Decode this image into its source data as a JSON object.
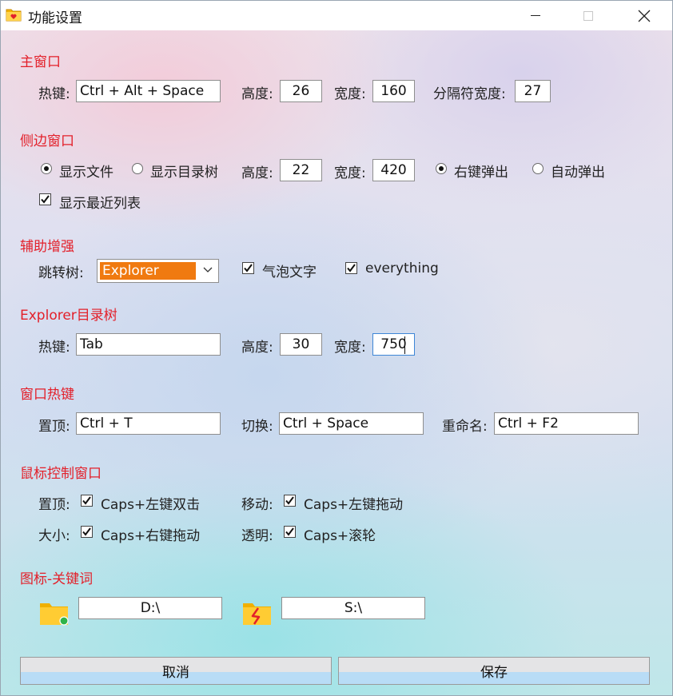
{
  "window": {
    "title": "功能设置"
  },
  "main_window": {
    "title": "主窗口",
    "hotkey_label": "热键:",
    "hotkey_value": "Ctrl + Alt + Space",
    "height_label": "高度:",
    "height_value": "26",
    "width_label": "宽度:",
    "width_value": "160",
    "separator_width_label": "分隔符宽度:",
    "separator_width_value": "27"
  },
  "side_window": {
    "title": "侧边窗口",
    "radio_show_files": "显示文件",
    "radio_show_tree": "显示目录树",
    "show_mode_selected": "显示文件",
    "height_label": "高度:",
    "height_value": "22",
    "width_label": "宽度:",
    "width_value": "420",
    "radio_right_click": "右键弹出",
    "radio_auto_popup": "自动弹出",
    "popup_mode_selected": "右键弹出",
    "show_recent_label": "显示最近列表",
    "show_recent_checked": true
  },
  "assist": {
    "title": "辅助增强",
    "jump_tree_label": "跳转树:",
    "jump_tree_value": "Explorer",
    "bubble_text_label": "气泡文字",
    "bubble_text_checked": true,
    "everything_label": "everything",
    "everything_checked": true
  },
  "explorer_tree": {
    "title": "Explorer目录树",
    "hotkey_label": "热键:",
    "hotkey_value": "Tab",
    "height_label": "高度:",
    "height_value": "30",
    "width_label": "宽度:",
    "width_value": "750"
  },
  "window_hotkeys": {
    "title": "窗口热键",
    "top_label": "置顶:",
    "top_value": "Ctrl + T",
    "switch_label": "切换:",
    "switch_value": "Ctrl + Space",
    "rename_label": "重命名:",
    "rename_value": "Ctrl + F2"
  },
  "mouse_control": {
    "title": "鼠标控制窗口",
    "top_label": "置顶:",
    "top_action": "Caps+左键双击",
    "move_label": "移动:",
    "move_action": "Caps+左键拖动",
    "size_label": "大小:",
    "size_action": "Caps+右键拖动",
    "transparent_label": "透明:",
    "transparent_action": "Caps+滚轮"
  },
  "icon_keywords": {
    "title": "图标-关键词",
    "items": [
      {
        "icon": "folder-dot-icon",
        "value": "D:\\"
      },
      {
        "icon": "folder-bolt-icon",
        "value": "S:\\"
      }
    ]
  },
  "buttons": {
    "cancel": "取消",
    "save": "保存"
  },
  "colors": {
    "section_title": "#e3202a",
    "combo_highlight": "#f07a10",
    "button_bottom": "#b8dcf6"
  }
}
